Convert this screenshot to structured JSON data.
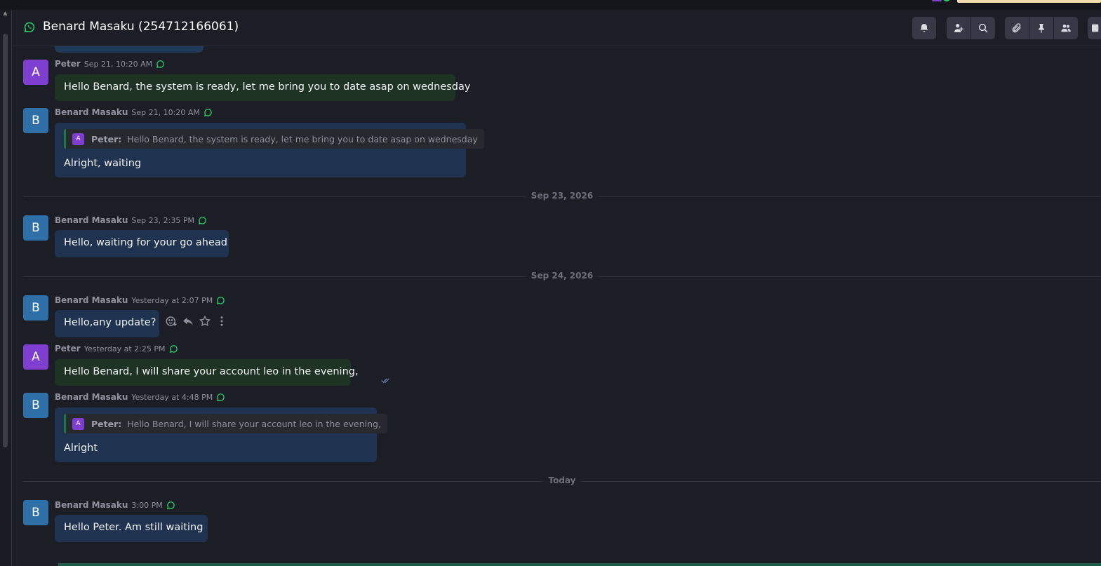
{
  "header": {
    "title": "Benard Masaku (254712166061)",
    "buttons": [
      "bell-icon",
      "add-user-icon",
      "search-icon",
      "paperclip-icon",
      "pin-icon",
      "users-icon",
      "panel-icon"
    ]
  },
  "colors": {
    "whatsapp_green": "#25d366",
    "avatar_peter": "#7e3fd0",
    "avatar_benard": "#2f6fa8",
    "outgoing_bubble": "#1e3323",
    "incoming_bubble": "#1f3350"
  },
  "messages": [
    {
      "avatar": "A",
      "name": "Peter",
      "time": "Sep 21, 10:20 AM",
      "text": "Hello Benard, the system is ready, let me bring you to date asap on wednesday"
    },
    {
      "avatar": "B",
      "name": "Benard Masaku",
      "time": "Sep 21, 10:20 AM",
      "quote": {
        "avatar": "A",
        "name": "Peter:",
        "text": "Hello Benard, the system is ready, let me bring you to date asap on wednesday"
      },
      "text": "Alright, waiting"
    },
    {
      "avatar": "B",
      "name": "Benard Masaku",
      "time": "Sep 23, 2:35 PM",
      "text": "Hello, waiting for your go ahead"
    },
    {
      "avatar": "B",
      "name": "Benard Masaku",
      "time": "Yesterday at 2:07 PM",
      "text": "Hello,any update?"
    },
    {
      "avatar": "A",
      "name": "Peter",
      "time": "Yesterday at 2:25 PM",
      "text": "Hello Benard, I will share your account leo in the evening,"
    },
    {
      "avatar": "B",
      "name": "Benard Masaku",
      "time": "Yesterday at 4:48 PM",
      "quote": {
        "avatar": "A",
        "name": "Peter:",
        "text": "Hello Benard, I will share your account leo in the evening,"
      },
      "text": "Alright"
    },
    {
      "avatar": "B",
      "name": "Benard Masaku",
      "time": "3:00 PM",
      "text": "Hello Peter. Am still waiting"
    }
  ],
  "separators": [
    "Sep 23, 2026",
    "Sep 24, 2026",
    "Today"
  ],
  "hover_actions": [
    "add-reaction-icon",
    "reply-icon",
    "star-icon",
    "more-vertical-icon"
  ]
}
